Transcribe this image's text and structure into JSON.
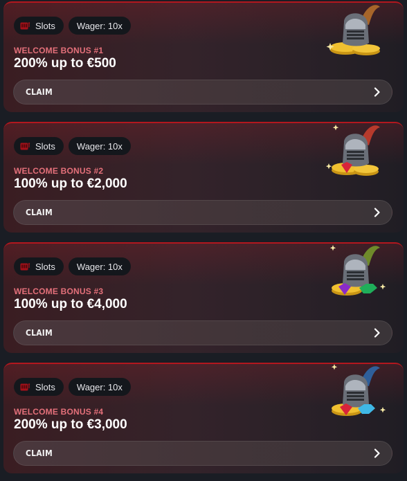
{
  "bonuses": [
    {
      "tag_category": "Slots",
      "tag_wager": "Wager: 10x",
      "label": "WELCOME BONUS #1",
      "amount": "200% up to €500",
      "claim_label": "CLAIM",
      "plume_color": "#a7652a",
      "gem_colors": []
    },
    {
      "tag_category": "Slots",
      "tag_wager": "Wager: 10x",
      "label": "WELCOME BONUS #2",
      "amount": "100% up to €2,000",
      "claim_label": "CLAIM",
      "plume_color": "#b73a2c",
      "gem_colors": [
        "#d8243a"
      ]
    },
    {
      "tag_category": "Slots",
      "tag_wager": "Wager: 10x",
      "label": "WELCOME BONUS #3",
      "amount": "100% up to €4,000",
      "claim_label": "CLAIM",
      "plume_color": "#6f8a2a",
      "gem_colors": [
        "#8a2bc8",
        "#1fae5a"
      ]
    },
    {
      "tag_category": "Slots",
      "tag_wager": "Wager: 10x",
      "label": "WELCOME BONUS #4",
      "amount": "200% up to €3,000",
      "claim_label": "CLAIM",
      "plume_color": "#2f5f9a",
      "gem_colors": [
        "#d8243a",
        "#3fb8e6"
      ]
    }
  ],
  "icons": {
    "category": "slot-machine-icon",
    "claim": "chevron-right-icon",
    "art": "knight-helmet-coins-icon"
  },
  "colors": {
    "accent_border": "#b3171e",
    "label_pink": "#e4707a",
    "tag_bg": "#14171c"
  }
}
